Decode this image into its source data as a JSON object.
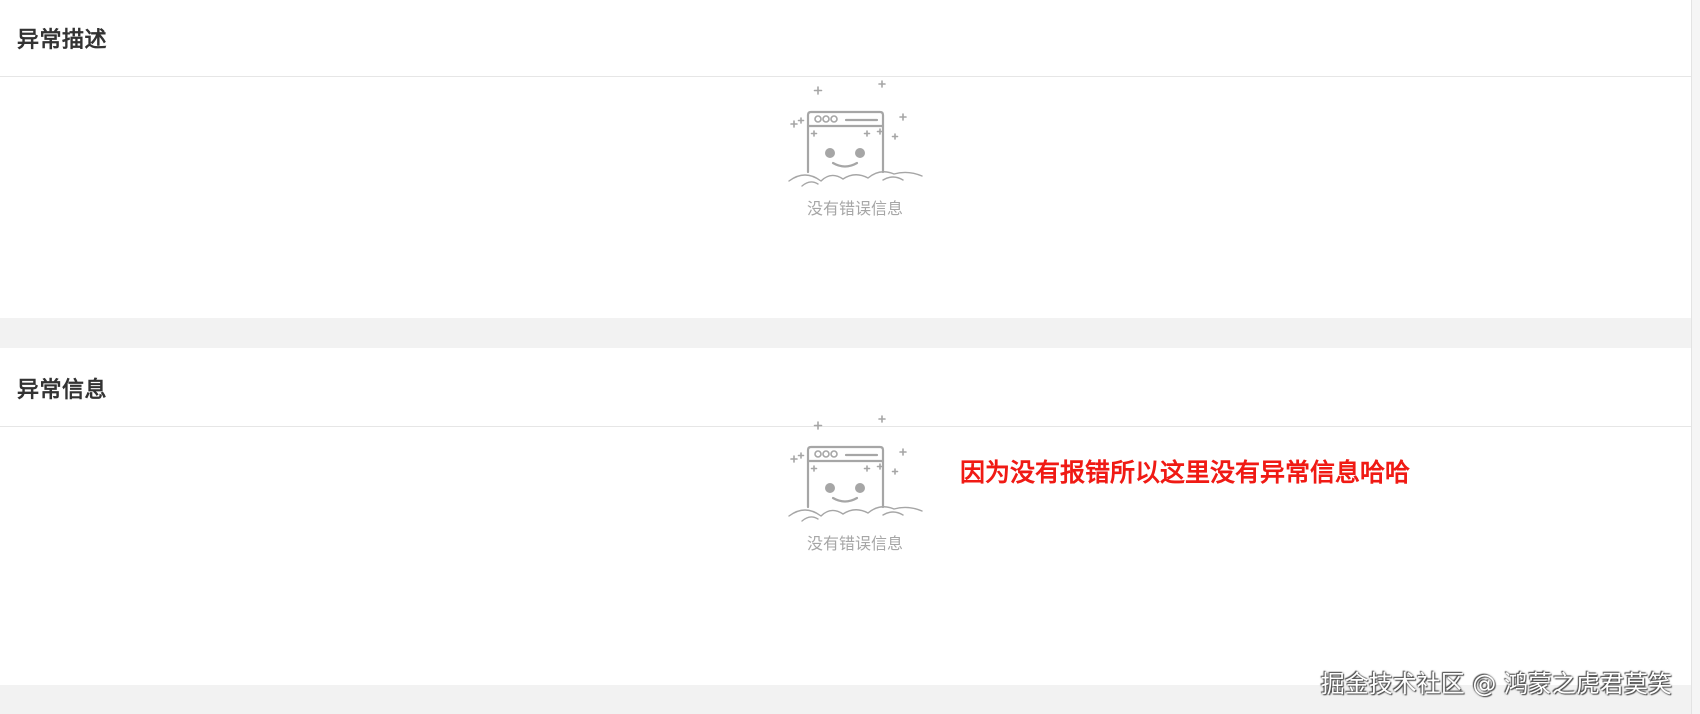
{
  "sections": {
    "description": {
      "title": "异常描述",
      "empty_text": "没有错误信息",
      "empty_icon": "empty-browser-smile-icon"
    },
    "information": {
      "title": "异常信息",
      "empty_text": "没有错误信息",
      "empty_icon": "empty-browser-smile-icon"
    }
  },
  "annotation": {
    "text": "因为没有报错所以这里没有异常信息哈哈",
    "color": "#f01a14"
  },
  "watermark": {
    "text": "掘金技术社区 @ 鸿蒙之虎君莫笑"
  },
  "colors": {
    "page_background": "#f2f2f2",
    "panel_background": "#ffffff",
    "empty_icon": "#a6a6a6"
  }
}
